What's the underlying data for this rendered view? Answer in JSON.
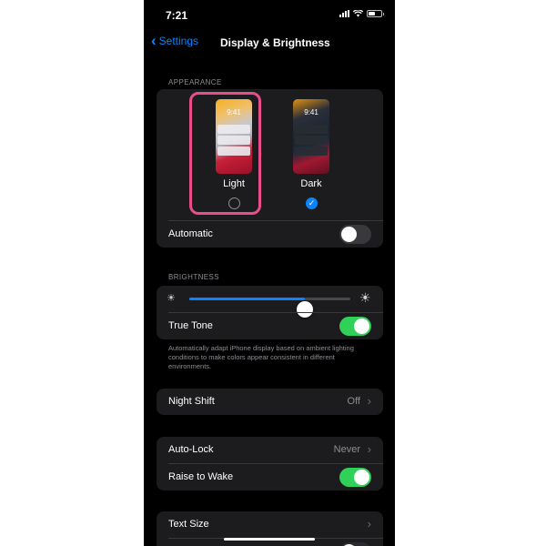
{
  "status_bar": {
    "time": "7:21",
    "battery_level": 0.5
  },
  "nav": {
    "back_label": "Settings",
    "title": "Display & Brightness"
  },
  "appearance": {
    "section_label": "APPEARANCE",
    "options": [
      {
        "label": "Light",
        "preview_time": "9:41",
        "selected": false
      },
      {
        "label": "Dark",
        "preview_time": "9:41",
        "selected": true
      }
    ],
    "automatic": {
      "label": "Automatic",
      "on": false
    }
  },
  "brightness": {
    "section_label": "BRIGHTNESS",
    "slider_level": 0.72,
    "true_tone": {
      "label": "True Tone",
      "on": true
    },
    "footnote": "Automatically adapt iPhone display based on ambient lighting conditions to make colors appear consistent in different environments."
  },
  "night_shift": {
    "label": "Night Shift",
    "value": "Off"
  },
  "lock": {
    "auto_lock": {
      "label": "Auto-Lock",
      "value": "Never"
    },
    "raise_to_wake": {
      "label": "Raise to Wake",
      "on": true
    }
  },
  "text": {
    "text_size": {
      "label": "Text Size"
    }
  },
  "colors": {
    "accent": "#0a84ff",
    "toggle_on": "#30d158",
    "highlight": "#e94e8b"
  }
}
